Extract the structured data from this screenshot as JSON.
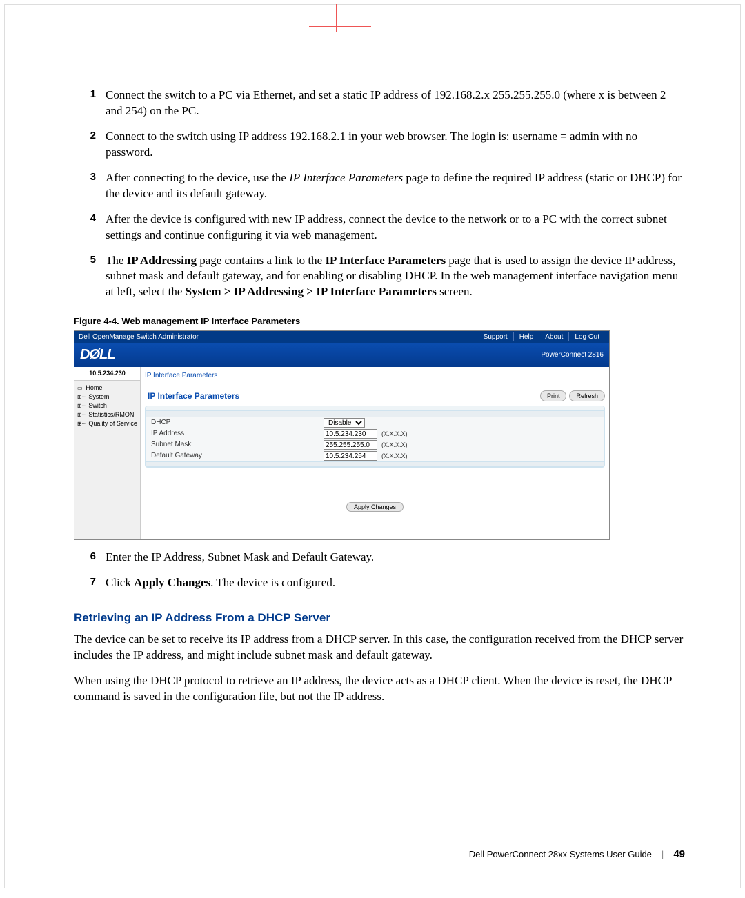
{
  "steps": [
    {
      "n": "1",
      "t": "Connect the switch to a PC via Ethernet, and set a static IP address of 192.168.2.x 255.255.255.0 (where x is between 2 and 254) on the PC."
    },
    {
      "n": "2",
      "t": "Connect to the switch using IP address 192.168.2.1 in your web browser. The login is: username = admin with no password."
    },
    {
      "n": "3",
      "t1": "After connecting to the device, use the ",
      "it": "IP Interface Parameters",
      "t2": " page to define the required IP address (static or DHCP) for the device and its default gateway."
    },
    {
      "n": "4",
      "t": "After the device is configured with new IP address, connect the device to the network or to a PC with the correct subnet settings and continue configuring it via web management."
    },
    {
      "n": "5",
      "t1": "The ",
      "b1": "IP Addressing",
      "t2": " page contains a link to the ",
      "b2": "IP Interface Parameters",
      "t3": " page that is used to assign the device IP address, subnet mask and default gateway, and for enabling or disabling DHCP. In the web management interface navigation menu at left, select the ",
      "b3": "System > IP Addressing > IP Interface Parameters",
      "t4": " screen."
    }
  ],
  "figure": {
    "caption": "Figure 4-4.    Web management IP Interface Parameters"
  },
  "ui": {
    "app_title": "Dell OpenManage Switch Administrator",
    "top_links": [
      "Support",
      "Help",
      "About",
      "Log Out"
    ],
    "logo": "DØLL",
    "model": "PowerConnect 2816",
    "device_ip": "10.5.234.230",
    "tree": [
      "Home",
      "System",
      "Switch",
      "Statistics/RMON",
      "Quality of Service"
    ],
    "breadcrumb": "IP Interface Parameters",
    "panel_title": "IP Interface Parameters",
    "buttons": {
      "print": "Print",
      "refresh": "Refresh",
      "apply": "Apply Changes"
    },
    "form": {
      "dhcp": {
        "label": "DHCP",
        "value": "Disable"
      },
      "ip": {
        "label": "IP Address",
        "value": "10.5.234.230",
        "hint": "(X.X.X.X)"
      },
      "mask": {
        "label": "Subnet Mask",
        "value": "255.255.255.0",
        "hint": "(X.X.X.X)"
      },
      "gw": {
        "label": "Default Gateway",
        "value": "10.5.234.254",
        "hint": "(X.X.X.X)"
      }
    }
  },
  "steps2": [
    {
      "n": "6",
      "t": "Enter the IP Address, Subnet Mask and Default Gateway."
    },
    {
      "n": "7",
      "t1": "Click ",
      "b": "Apply Changes",
      "t2": ". The device is configured."
    }
  ],
  "section": {
    "heading": "Retrieving an IP Address From a DHCP Server",
    "p1": "The device can be set to receive its IP address from a DHCP server. In this case, the configuration received from the DHCP server includes the IP address, and might include subnet mask and default gateway.",
    "p2": "When using the DHCP protocol to retrieve an IP address, the device acts as a DHCP client. When the device is reset, the DHCP command is saved in the configuration file, but not the IP address."
  },
  "footer": {
    "title": "Dell PowerConnect 28xx Systems User Guide",
    "page": "49"
  }
}
